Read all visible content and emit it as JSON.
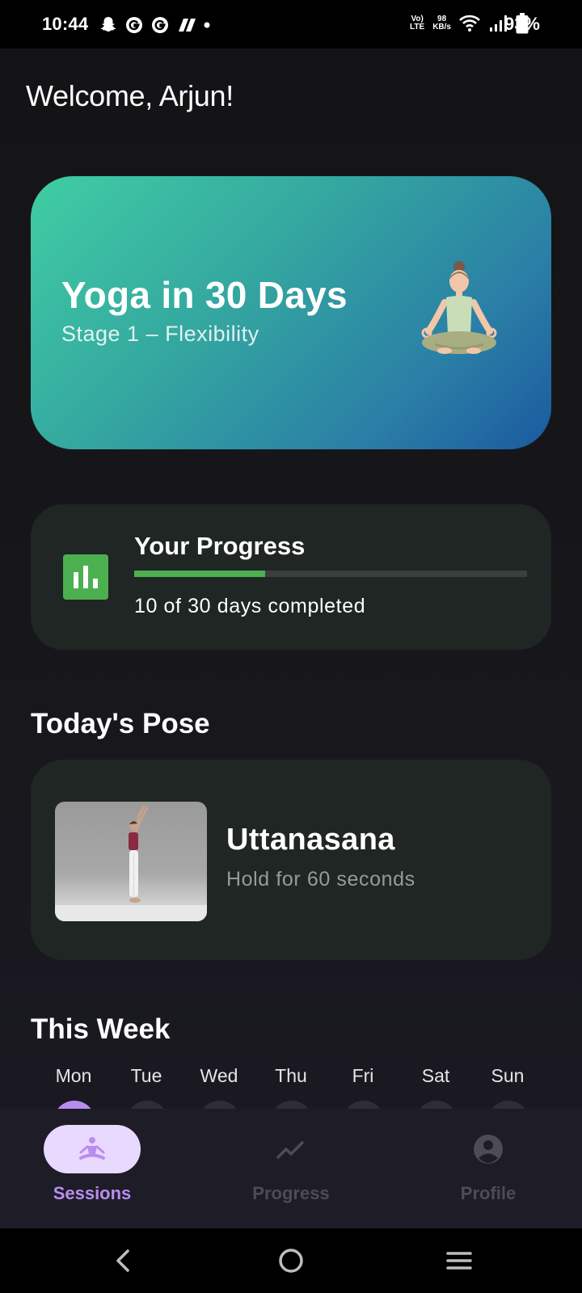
{
  "status_bar": {
    "time": "10:44",
    "net_volte": "Vo)",
    "net_lte": "LTE",
    "net_speed": "98",
    "net_speed_unit": "KB/s",
    "battery": "93%"
  },
  "greeting": "Welcome, Arjun!",
  "hero": {
    "title": "Yoga in 30 Days",
    "subtitle": "Stage 1 – Flexibility",
    "illustration": "meditating-person-illustration"
  },
  "progress": {
    "title": "Your Progress",
    "summary": "10 of 30 days completed",
    "fraction": 0.3333,
    "icon": "bar-chart-icon",
    "accent": "#4caf50"
  },
  "today": {
    "section_title": "Today's Pose",
    "pose_name": "Uttanasana",
    "instruction": "Hold for 60 seconds"
  },
  "week": {
    "section_title": "This Week",
    "days": [
      {
        "label": "Mon",
        "active": true
      },
      {
        "label": "Tue",
        "active": false
      },
      {
        "label": "Wed",
        "active": false
      },
      {
        "label": "Thu",
        "active": false
      },
      {
        "label": "Fri",
        "active": false
      },
      {
        "label": "Sat",
        "active": false
      },
      {
        "label": "Sun",
        "active": false
      }
    ]
  },
  "bottom_nav": {
    "items": [
      {
        "label": "Sessions",
        "icon": "yoga-icon",
        "active": true
      },
      {
        "label": "Progress",
        "icon": "trending-icon",
        "active": false
      },
      {
        "label": "Profile",
        "icon": "account-circle-icon",
        "active": false
      }
    ]
  },
  "colors": {
    "accent_purple": "#b98df0",
    "pill_active": "#ead9ff",
    "card_bg": "#1f2623",
    "hero_gradient_start": "#40cda3",
    "hero_gradient_end": "#1b5aa0"
  }
}
